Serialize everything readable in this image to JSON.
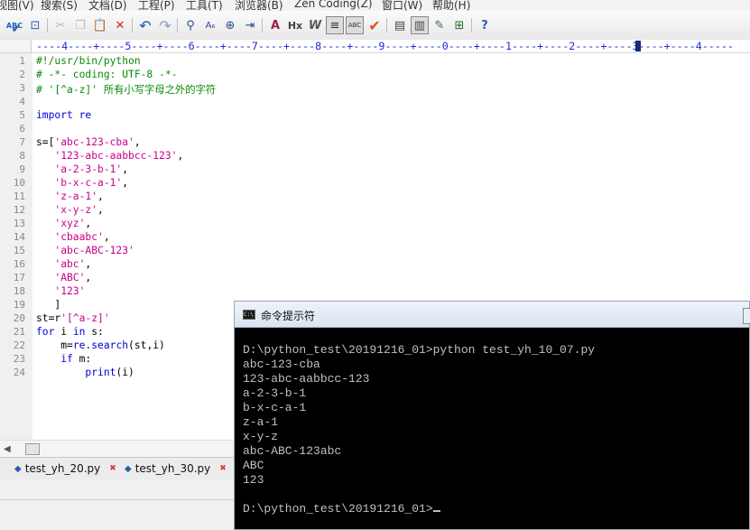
{
  "menubar": {
    "items": [
      "视图(V)",
      "搜索(S)",
      "文档(D)",
      "工程(P)",
      "工具(T)",
      "浏览器(B)",
      "Zen Coding(Z)",
      "窗口(W)",
      "帮助(H)"
    ]
  },
  "toolbar": {
    "icons": [
      "spellcheck-icon",
      "spellcheck-run-icon",
      "window-icon",
      "cut-icon",
      "copy-icon",
      "paste-icon",
      "delete-icon",
      "undo-icon",
      "redo-icon",
      "find-icon",
      "replace-icon",
      "find-in-files-icon",
      "goto-line-icon",
      "font-icon",
      "heading-icon",
      "italic-w-icon",
      "word-wrap-icon",
      "spell-toggle-icon",
      "checkmark-icon",
      "view-list-icon",
      "view-split-icon",
      "edit-icon",
      "browser-icon",
      "help-icon"
    ]
  },
  "ruler": {
    "text": "----4----+----5----+----6----+----7----+----8----+----9----+----0----+----1----+----2----+----3----+----4-----"
  },
  "editor": {
    "line_numbers": [
      "1",
      "2",
      "3",
      "4",
      "5",
      "6",
      "7",
      "8",
      "9",
      "10",
      "11",
      "12",
      "13",
      "14",
      "15",
      "16",
      "17",
      "18",
      "19",
      "20",
      "21",
      "22",
      "23",
      "24"
    ],
    "lines": [
      [
        {
          "t": "#!/usr/bin/python",
          "c": "cm"
        }
      ],
      [
        {
          "t": "# -*- coding: UTF-8 -*-",
          "c": "cm"
        }
      ],
      [
        {
          "t": "# '[^a-z]' 所有小写字母之外的字符",
          "c": "cm"
        }
      ],
      [],
      [
        {
          "t": "import",
          "c": "kw"
        },
        {
          "t": " re",
          "c": "fn"
        }
      ],
      [],
      [
        {
          "t": "s=[",
          "c": ""
        },
        {
          "t": "'abc-123-cba'",
          "c": "st"
        },
        {
          "t": ",",
          "c": ""
        }
      ],
      [
        {
          "t": "   ",
          "c": ""
        },
        {
          "t": "'123-abc-aabbcc-123'",
          "c": "st"
        },
        {
          "t": ",",
          "c": ""
        }
      ],
      [
        {
          "t": "   ",
          "c": ""
        },
        {
          "t": "'a-2-3-b-1'",
          "c": "st"
        },
        {
          "t": ",",
          "c": ""
        }
      ],
      [
        {
          "t": "   ",
          "c": ""
        },
        {
          "t": "'b-x-c-a-1'",
          "c": "st"
        },
        {
          "t": ",",
          "c": ""
        }
      ],
      [
        {
          "t": "   ",
          "c": ""
        },
        {
          "t": "'z-a-1'",
          "c": "st"
        },
        {
          "t": ",",
          "c": ""
        }
      ],
      [
        {
          "t": "   ",
          "c": ""
        },
        {
          "t": "'x-y-z'",
          "c": "st"
        },
        {
          "t": ",",
          "c": ""
        }
      ],
      [
        {
          "t": "   ",
          "c": ""
        },
        {
          "t": "'xyz'",
          "c": "st"
        },
        {
          "t": ",",
          "c": ""
        }
      ],
      [
        {
          "t": "   ",
          "c": ""
        },
        {
          "t": "'cbaabc'",
          "c": "st"
        },
        {
          "t": ",",
          "c": ""
        }
      ],
      [
        {
          "t": "   ",
          "c": ""
        },
        {
          "t": "'abc-ABC-123'",
          "c": "st"
        }
      ],
      [
        {
          "t": "   ",
          "c": ""
        },
        {
          "t": "'abc'",
          "c": "st"
        },
        {
          "t": ",",
          "c": ""
        }
      ],
      [
        {
          "t": "   ",
          "c": ""
        },
        {
          "t": "'ABC'",
          "c": "st"
        },
        {
          "t": ",",
          "c": ""
        }
      ],
      [
        {
          "t": "   ",
          "c": ""
        },
        {
          "t": "'123'",
          "c": "st"
        }
      ],
      [
        {
          "t": "   ]",
          "c": ""
        }
      ],
      [
        {
          "t": "st=r",
          "c": ""
        },
        {
          "t": "'[^a-z]'",
          "c": "st"
        }
      ],
      [
        {
          "t": "for",
          "c": "kw"
        },
        {
          "t": " i ",
          "c": ""
        },
        {
          "t": "in",
          "c": "kw"
        },
        {
          "t": " s:",
          "c": ""
        }
      ],
      [
        {
          "t": "    m=",
          "c": ""
        },
        {
          "t": "re",
          "c": "fn"
        },
        {
          "t": ".",
          "c": ""
        },
        {
          "t": "search",
          "c": "fn"
        },
        {
          "t": "(st,i)",
          "c": ""
        }
      ],
      [
        {
          "t": "    ",
          "c": ""
        },
        {
          "t": "if",
          "c": "kw"
        },
        {
          "t": " m:",
          "c": ""
        }
      ],
      [
        {
          "t": "        ",
          "c": ""
        },
        {
          "t": "print",
          "c": "fn"
        },
        {
          "t": "(i)",
          "c": ""
        }
      ]
    ]
  },
  "tabs": [
    {
      "label": "test_yh_20.py"
    },
    {
      "label": "test_yh_30.py"
    }
  ],
  "cmd_window": {
    "title": "命令提示符",
    "lines": [
      "D:\\python_test\\20191216_01>python test_yh_10_07.py",
      "abc-123-cba",
      "123-abc-aabbcc-123",
      "a-2-3-b-1",
      "b-x-c-a-1",
      "z-a-1",
      "x-y-z",
      "abc-ABC-123abc",
      "ABC",
      "123",
      "",
      "D:\\python_test\\20191216_01>"
    ]
  },
  "colors": {
    "comment": "#0a8a0a",
    "keyword": "#0000e0",
    "string": "#c8008c",
    "ruler": "#1c2bd4"
  }
}
